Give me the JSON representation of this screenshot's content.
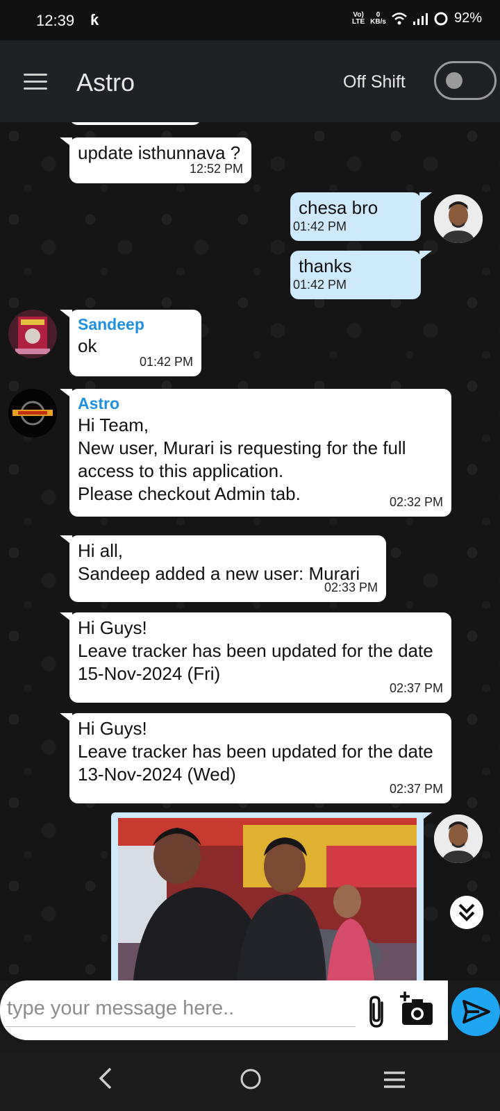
{
  "status": {
    "time": "12:39",
    "network": "LTE",
    "speed_value": "0",
    "speed_unit": "KB/s",
    "battery": "92%"
  },
  "header": {
    "title": "Astro",
    "shift_label": "Off Shift",
    "toggle_on": false
  },
  "messages": [
    {
      "type": "in",
      "text": "update isthunnava ?",
      "time": "12:52 PM"
    },
    {
      "type": "out",
      "text": "chesa bro",
      "time": "01:42 PM"
    },
    {
      "type": "out",
      "text": "thanks",
      "time": "01:42 PM"
    },
    {
      "type": "in",
      "sender": "Sandeep",
      "text": "ok",
      "time": "01:42 PM"
    },
    {
      "type": "in",
      "sender": "Astro",
      "text": "Hi Team,\nNew user, Murari is requesting for the full access to this application.\nPlease checkout Admin tab.",
      "time": "02:32 PM"
    },
    {
      "type": "in",
      "text": "Hi all,\nSandeep added a new user: Murari",
      "time": "02:33 PM"
    },
    {
      "type": "in",
      "text": "Hi Guys!\nLeave tracker has been updated for the date 15-Nov-2024 (Fri)",
      "time": "02:37 PM"
    },
    {
      "type": "in",
      "text": "Hi Guys!\nLeave tracker has been updated for the date 13-Nov-2024 (Wed)",
      "time": "02:37 PM"
    }
  ],
  "input": {
    "placeholder": "type your message here.."
  },
  "colors": {
    "accent": "#1ea6f2",
    "sender": "#1e90e0",
    "outgoing_bubble": "#cde9fb",
    "header": "#202124"
  }
}
